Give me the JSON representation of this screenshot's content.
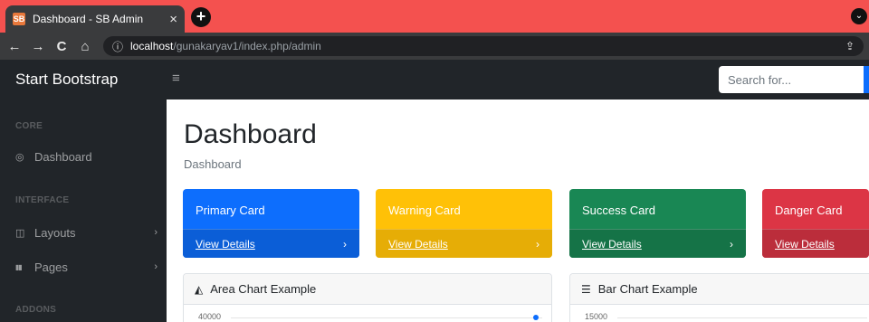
{
  "browser": {
    "tab_title": "Dashboard - SB Admin",
    "favicon_text": "SB",
    "close_glyph": "×",
    "newtab_glyph": "+",
    "dropdown_glyph": "⌄",
    "url_host": "localhost",
    "url_path": "/gunakaryav1/index.php/admin",
    "nav_back": "←",
    "nav_forward": "→",
    "nav_reload": "C",
    "nav_home": "⌂",
    "info_glyph": "ⓘ",
    "share_glyph": "⇪"
  },
  "topnav": {
    "brand": "Start Bootstrap",
    "toggle_glyph": "≡",
    "search_placeholder": "Search for..."
  },
  "sidebar": {
    "headings": {
      "core": "CORE",
      "interface": "INTERFACE",
      "addons": "ADDONS"
    },
    "items": [
      {
        "label": "Dashboard",
        "icon": "dashboard-icon",
        "glyph": "◎"
      },
      {
        "label": "Layouts",
        "icon": "columns-icon",
        "glyph": "◫",
        "chevron": "›"
      },
      {
        "label": "Pages",
        "icon": "book-icon",
        "glyph": "▮▮",
        "chevron": "›"
      }
    ]
  },
  "main": {
    "title": "Dashboard",
    "breadcrumb": "Dashboard",
    "cards": [
      {
        "title": "Primary Card",
        "link": "View Details",
        "arrow": "›",
        "color": "#0d6efd"
      },
      {
        "title": "Warning Card",
        "link": "View Details",
        "arrow": "›",
        "color": "#ffc107"
      },
      {
        "title": "Success Card",
        "link": "View Details",
        "arrow": "›",
        "color": "#198754"
      },
      {
        "title": "Danger Card",
        "link": "View Details",
        "arrow": "›",
        "color": "#dc3545"
      }
    ],
    "area_chart": {
      "title": "Area Chart Example",
      "icon": "area-chart-icon",
      "glyph": "◭",
      "ytick": "40000"
    },
    "bar_chart": {
      "title": "Bar Chart Example",
      "icon": "bar-chart-icon",
      "glyph": "☰",
      "ytick": "15000"
    }
  }
}
